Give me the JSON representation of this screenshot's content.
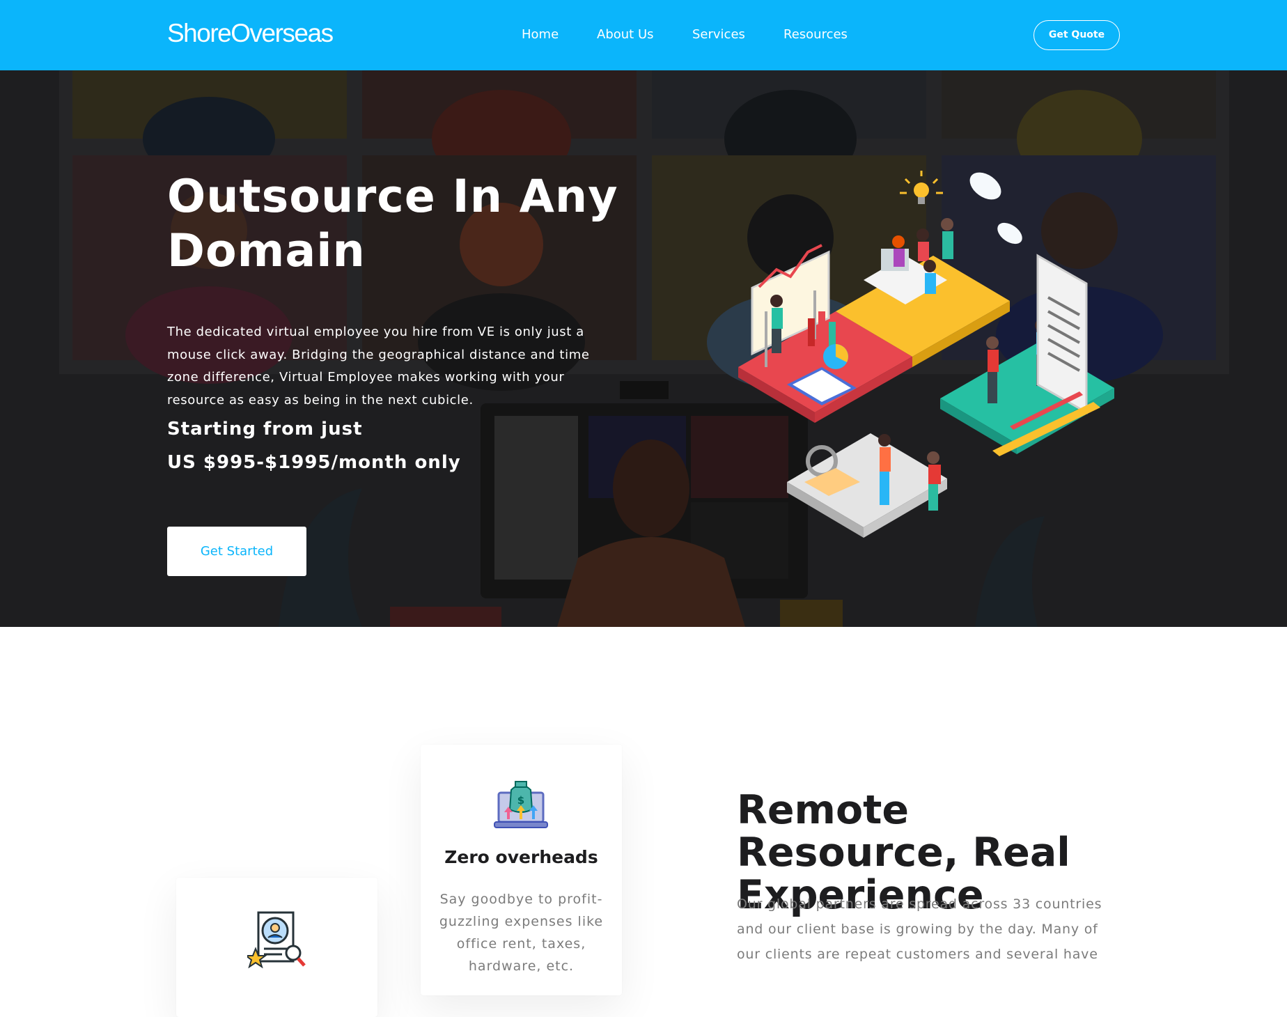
{
  "brand": {
    "logo": "ShoreOverseas",
    "accent": "#0bb5fb",
    "dark_bg": "#1d1d1f"
  },
  "nav": {
    "items": [
      {
        "label": "Home"
      },
      {
        "label": "About Us"
      },
      {
        "label": "Services"
      },
      {
        "label": "Resources"
      }
    ],
    "cta_label": "Get Quote"
  },
  "hero": {
    "title": "Outsource In Any Domain",
    "description": "The dedicated virtual employee you hire from VE is only just a mouse click away. Bridging the geographical distance and time zone difference, Virtual Employee makes working with your resource as easy as being in the next cubicle.",
    "price_line1": "Starting from just",
    "price_line2": "US $995-$1995/month only",
    "cta_label": "Get Started",
    "illustration_icon": "isometric-puzzle-team-illustration"
  },
  "features": {
    "cards": [
      {
        "icon": "laptop-money-bag-icon",
        "title": "Zero overheads",
        "description": "Say goodbye to profit-guzzling expenses like office rent, taxes, hardware, etc."
      },
      {
        "icon": "resume-search-icon",
        "title": "",
        "description": ""
      }
    ]
  },
  "about": {
    "title": "Remote Resource, Real Experience",
    "description": "Our global partners are spread across 33 countries and our client base is growing by the day. Many of our clients are repeat customers and several have"
  }
}
